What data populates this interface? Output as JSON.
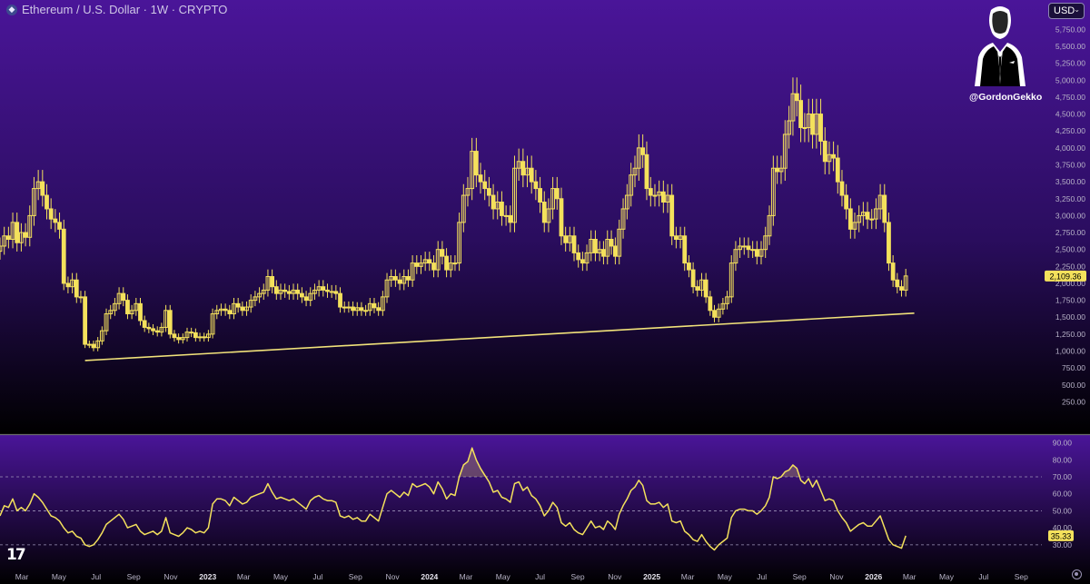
{
  "header": {
    "symbol_title": "Ethereum / U.S. Dollar · 1W · CRYPTO",
    "currency": "USD"
  },
  "watermark": {
    "handle": "@GordonGekko"
  },
  "colors": {
    "candle": "#f4e15c",
    "trendline": "#f1e27a",
    "rsi_line": "#f4e15c",
    "label_bg": "#f4e15c",
    "bg_top": "#4a1599",
    "bg_bottom": "#000000"
  },
  "chart_data": [
    {
      "type": "candlestick",
      "title": "Ethereum / U.S. Dollar · 1W · CRYPTO",
      "y_tick_labels": [
        "5,750.00",
        "5,500.00",
        "5,250.00",
        "5,000.00",
        "4,750.00",
        "4,500.00",
        "4,250.00",
        "4,000.00",
        "3,750.00",
        "3,500.00",
        "3,250.00",
        "3,000.00",
        "2,750.00",
        "2,500.00",
        "2,250.00",
        "2,000.00",
        "1,750.00",
        "1,500.00",
        "1,250.00",
        "1,000.00",
        "750.00",
        "500.00",
        "250.00"
      ],
      "y_ticks": [
        5750,
        5500,
        5250,
        5000,
        4750,
        4500,
        4250,
        4000,
        3750,
        3500,
        3250,
        3000,
        2750,
        2500,
        2250,
        2000,
        1750,
        1500,
        1250,
        1000,
        750,
        500,
        250
      ],
      "ylim": [
        -200,
        6050
      ],
      "last_price_label": "2,109.36",
      "last_price": 2109.36,
      "trendline": {
        "start": {
          "date": "2022-06-13",
          "value": 860
        },
        "end": {
          "date": "2026-03-09",
          "value": 1560
        }
      },
      "x_tick_labels": [
        "Mar",
        "May",
        "Jul",
        "Sep",
        "Nov",
        "2023",
        "Mar",
        "May",
        "Jul",
        "Sep",
        "Nov",
        "2024",
        "Mar",
        "May",
        "Jul",
        "Sep",
        "Nov",
        "2025",
        "Mar",
        "May",
        "Jul",
        "Sep",
        "Nov",
        "2026",
        "Mar",
        "May",
        "Jul",
        "Sep"
      ],
      "x_ticks": [
        "2022-03-01",
        "2022-05-01",
        "2022-07-01",
        "2022-09-01",
        "2022-11-01",
        "2023-01-01",
        "2023-03-01",
        "2023-05-01",
        "2023-07-01",
        "2023-09-01",
        "2023-11-01",
        "2024-01-01",
        "2024-03-01",
        "2024-05-01",
        "2024-07-01",
        "2024-09-01",
        "2024-11-01",
        "2025-01-01",
        "2025-03-01",
        "2025-05-01",
        "2025-07-01",
        "2025-09-01",
        "2025-11-01",
        "2026-01-01",
        "2026-03-01",
        "2026-05-01",
        "2026-07-01",
        "2026-09-01"
      ],
      "x_range": [
        "2022-01-24",
        "2026-10-05"
      ],
      "series": [
        {
          "start": "2022-01-24",
          "end": "2022-03-07",
          "values": [
            2550,
            2700,
            2650,
            2900,
            2600,
            2750,
            2680
          ]
        },
        {
          "start": "2022-03-14",
          "end": "2022-05-02",
          "values": [
            3000,
            3400,
            3500,
            3300,
            3100,
            2950,
            2900,
            2800
          ]
        },
        {
          "start": "2022-05-09",
          "end": "2022-06-06",
          "values": [
            2000,
            1950,
            2050,
            1800,
            1800
          ]
        },
        {
          "start": "2022-06-13",
          "end": "2022-07-11",
          "values": [
            1100,
            1100,
            1050,
            1150,
            1300
          ]
        },
        {
          "start": "2022-07-18",
          "end": "2022-08-29",
          "values": [
            1550,
            1600,
            1700,
            1850,
            1750,
            1550,
            1600
          ]
        },
        {
          "start": "2022-09-05",
          "end": "2022-11-28",
          "values": [
            1700,
            1450,
            1350,
            1330,
            1300,
            1280,
            1350,
            1600,
            1250,
            1200,
            1170,
            1200,
            1280
          ]
        },
        {
          "start": "2022-12-05",
          "end": "2023-01-30",
          "values": [
            1270,
            1200,
            1210,
            1200,
            1250,
            1550,
            1600,
            1620,
            1600
          ]
        },
        {
          "start": "2023-02-06",
          "end": "2023-04-10",
          "values": [
            1550,
            1700,
            1650,
            1600,
            1650,
            1750,
            1800,
            1850,
            1900,
            2100
          ]
        },
        {
          "start": "2023-04-17",
          "end": "2023-06-26",
          "values": [
            1950,
            1850,
            1900,
            1880,
            1850,
            1900,
            1850,
            1800,
            1750,
            1850,
            1900
          ]
        },
        {
          "start": "2023-07-03",
          "end": "2023-09-25",
          "values": [
            1950,
            1900,
            1880,
            1880,
            1850,
            1650,
            1650,
            1650,
            1600,
            1640,
            1600,
            1600,
            1700
          ]
        },
        {
          "start": "2023-10-02",
          "end": "2023-12-25",
          "values": [
            1640,
            1600,
            1800,
            2050,
            2100,
            2050,
            2000,
            2100,
            2050,
            2300,
            2250,
            2300,
            2350
          ]
        },
        {
          "start": "2024-01-01",
          "end": "2024-03-25",
          "values": [
            2300,
            2200,
            2500,
            2400,
            2200,
            2300,
            2300,
            2900,
            3300,
            3400,
            3950,
            3600,
            3500
          ]
        },
        {
          "start": "2024-04-01",
          "end": "2024-06-24",
          "values": [
            3400,
            3300,
            3100,
            3200,
            3000,
            3000,
            2900,
            3700,
            3800,
            3600,
            3700,
            3500,
            3400
          ]
        },
        {
          "start": "2024-07-01",
          "end": "2024-09-30",
          "values": [
            3200,
            2900,
            3100,
            3400,
            3250,
            2700,
            2600,
            2700,
            2450,
            2350,
            2300,
            2450,
            2650,
            2450
          ]
        },
        {
          "start": "2024-10-07",
          "end": "2024-12-30",
          "values": [
            2500,
            2400,
            2650,
            2550,
            2400,
            2800,
            3100,
            3300,
            3600,
            3700,
            4000,
            3900,
            3400,
            3300
          ]
        },
        {
          "start": "2025-01-06",
          "end": "2025-03-31",
          "values": [
            3300,
            3350,
            3200,
            3300,
            2700,
            2650,
            2700,
            2300,
            2200,
            1950,
            1900,
            2050,
            1800
          ]
        },
        {
          "start": "2025-04-07",
          "end": "2025-06-30",
          "values": [
            1600,
            1500,
            1620,
            1700,
            1800,
            2300,
            2500,
            2550,
            2550,
            2500,
            2500,
            2400,
            2500
          ]
        },
        {
          "start": "2025-07-07",
          "end": "2025-09-29",
          "values": [
            2700,
            3000,
            3700,
            3650,
            3700,
            4200,
            4400,
            4800,
            4700,
            4300,
            4300,
            4500,
            4200,
            4500
          ]
        },
        {
          "start": "2025-10-06",
          "end": "2025-12-29",
          "values": [
            4100,
            3800,
            3900,
            3850,
            3500,
            3300,
            3100,
            2800,
            2900,
            3000,
            3050,
            2950,
            2950
          ]
        },
        {
          "start": "2026-01-05",
          "end": "2026-02-23",
          "values": [
            3100,
            3300,
            2900,
            2300,
            2050,
            1950,
            1900,
            2109
          ]
        }
      ]
    },
    {
      "type": "line",
      "title": "",
      "y_tick_labels": [
        "90.00",
        "80.00",
        "70.00",
        "60.00",
        "50.00",
        "40.00",
        "30.00"
      ],
      "y_ticks": [
        90,
        80,
        70,
        60,
        50,
        40,
        30
      ],
      "ylim": [
        23.5,
        93
      ],
      "reference_lines": [
        70,
        50,
        30
      ],
      "last_value_label": "35.33",
      "last_value": 35.33,
      "series": [
        {
          "start": "2022-01-24",
          "end": "2022-03-07",
          "values": [
            47,
            53,
            52,
            57,
            50,
            52,
            50
          ]
        },
        {
          "start": "2022-03-14",
          "end": "2022-05-02",
          "values": [
            54,
            60,
            58,
            55,
            51,
            47,
            46,
            44
          ]
        },
        {
          "start": "2022-05-09",
          "end": "2022-06-06",
          "values": [
            40,
            37,
            38,
            35,
            34
          ]
        },
        {
          "start": "2022-06-13",
          "end": "2022-07-11",
          "values": [
            30,
            29,
            30,
            33,
            37
          ]
        },
        {
          "start": "2022-07-18",
          "end": "2022-08-29",
          "values": [
            42,
            44,
            46,
            48,
            45,
            40,
            41
          ]
        },
        {
          "start": "2022-09-05",
          "end": "2022-11-28",
          "values": [
            42,
            38,
            36,
            37,
            38,
            36,
            38,
            46,
            37,
            36,
            35,
            37,
            40
          ]
        },
        {
          "start": "2022-12-05",
          "end": "2023-01-30",
          "values": [
            39,
            37,
            38,
            37,
            40,
            54,
            57,
            57,
            56
          ]
        },
        {
          "start": "2023-02-06",
          "end": "2023-04-10",
          "values": [
            53,
            58,
            56,
            54,
            55,
            58,
            59,
            60,
            61,
            66
          ]
        },
        {
          "start": "2023-04-17",
          "end": "2023-06-26",
          "values": [
            61,
            57,
            58,
            57,
            56,
            57,
            55,
            53,
            51,
            56,
            58
          ]
        },
        {
          "start": "2023-07-03",
          "end": "2023-09-25",
          "values": [
            59,
            57,
            56,
            56,
            55,
            47,
            46,
            47,
            45,
            46,
            44,
            44,
            48
          ]
        },
        {
          "start": "2023-10-02",
          "end": "2023-12-25",
          "values": [
            46,
            44,
            52,
            60,
            62,
            60,
            58,
            61,
            59,
            66,
            64,
            65,
            66
          ]
        },
        {
          "start": "2024-01-01",
          "end": "2024-03-25",
          "values": [
            64,
            60,
            67,
            63,
            57,
            60,
            59,
            70,
            77,
            79,
            87,
            80,
            75
          ]
        },
        {
          "start": "2024-04-01",
          "end": "2024-06-24",
          "values": [
            71,
            67,
            61,
            62,
            58,
            57,
            55,
            66,
            67,
            62,
            64,
            59,
            57
          ]
        },
        {
          "start": "2024-07-01",
          "end": "2024-09-30",
          "values": [
            53,
            47,
            50,
            55,
            52,
            43,
            41,
            43,
            39,
            37,
            36,
            40,
            44,
            40
          ]
        },
        {
          "start": "2024-10-07",
          "end": "2024-12-30",
          "values": [
            41,
            39,
            44,
            42,
            39,
            48,
            53,
            57,
            62,
            64,
            68,
            65,
            56,
            54
          ]
        },
        {
          "start": "2025-01-06",
          "end": "2025-03-31",
          "values": [
            54,
            55,
            52,
            54,
            44,
            43,
            44,
            38,
            36,
            33,
            32,
            36,
            32
          ]
        },
        {
          "start": "2025-04-07",
          "end": "2025-06-30",
          "values": [
            29,
            27,
            30,
            32,
            34,
            46,
            50,
            51,
            51,
            50,
            50,
            48,
            50
          ]
        },
        {
          "start": "2025-07-07",
          "end": "2025-09-29",
          "values": [
            53,
            58,
            70,
            69,
            70,
            73,
            74,
            77,
            75,
            68,
            66,
            69,
            64,
            68
          ]
        },
        {
          "start": "2025-10-06",
          "end": "2025-12-29",
          "values": [
            62,
            56,
            57,
            56,
            50,
            46,
            43,
            38,
            40,
            42,
            43,
            41,
            41
          ]
        },
        {
          "start": "2026-01-05",
          "end": "2026-02-23",
          "values": [
            44,
            47,
            40,
            33,
            30,
            29,
            28,
            35.33
          ]
        }
      ]
    }
  ]
}
